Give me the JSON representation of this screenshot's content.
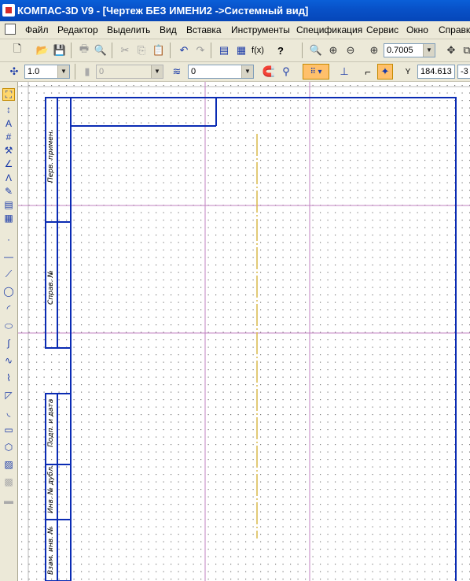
{
  "app": {
    "title": "КОМПАС-3D V9 - [Чертеж БЕЗ ИМЕНИ2 ->Системный вид]"
  },
  "menu": [
    "Файл",
    "Редактор",
    "Выделить",
    "Вид",
    "Вставка",
    "Инструменты",
    "Спецификация",
    "Сервис",
    "Окно",
    "Справка"
  ],
  "toolbar1": {
    "icons": [
      "new-document-icon",
      "open-icon",
      "save-icon",
      "print-icon",
      "print-preview-icon",
      "cut-icon",
      "copy-icon",
      "paste-icon",
      "undo-icon",
      "redo-icon",
      "manager-icon",
      "variables-icon",
      "function-icon",
      "help-icon",
      "zoom-icon",
      "zoom-in-icon",
      "zoom-out-icon",
      "zoom-scale-icon",
      "pan-icon"
    ],
    "function_label": "f(x)",
    "zoom_value": "0.7005"
  },
  "toolbar2": {
    "scale_value": "1.0",
    "style_value": "0",
    "layer_value": "0",
    "coord_label": "Y",
    "coord_value": "184.613",
    "coord_value2": "-3"
  },
  "sidebar": {
    "icons": [
      "select-icon",
      "dimension-icon",
      "text-icon",
      "hatch-icon",
      "measure-icon",
      "param-icon",
      "arc-tool-icon",
      "edit-icon",
      "spec-icon",
      "view-icon",
      "point-icon",
      "line-icon",
      "segment-icon",
      "circle-icon",
      "arc-icon",
      "ellipse-icon",
      "spline-icon",
      "bezier-icon",
      "polyline-icon",
      "chamfer-icon",
      "fillet-icon",
      "rectangle-icon",
      "polygon-icon",
      "hatch2-icon",
      "equidistant-icon",
      "cut-curve-icon"
    ]
  },
  "drawing": {
    "stamp_labels": [
      "Перв. примен.",
      "Справ. №",
      "Подп. и дата",
      "Инв. № дубл.",
      "Взам. инв. №"
    ],
    "colors": {
      "frame": "#0a2bb3",
      "grid": "#7a7a7a",
      "axis_h": "#c080c0",
      "axis_v": "#c080c0",
      "center_line": "#d9b84a"
    }
  }
}
